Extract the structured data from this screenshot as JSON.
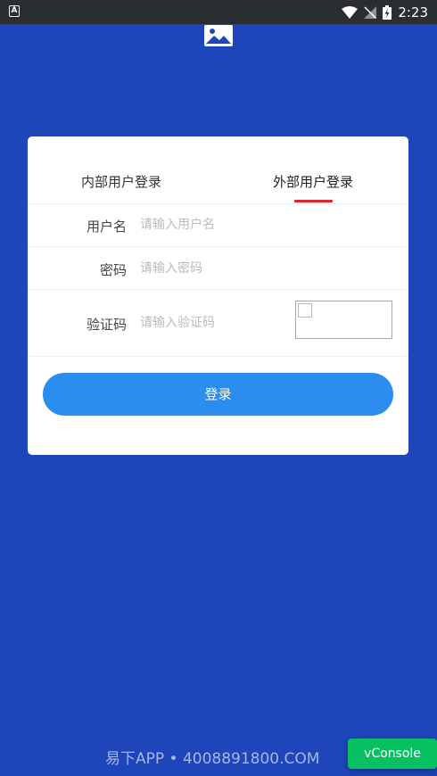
{
  "statusbar": {
    "time": "2:23",
    "app_icon_letter": "A"
  },
  "tabs": {
    "internal": "内部用户登录",
    "external": "外部用户登录",
    "active": "external",
    "active_color": "#e0242b"
  },
  "form": {
    "username_label": "用户名",
    "username_placeholder": "请输入用户名",
    "password_label": "密码",
    "password_placeholder": "请输入密码",
    "captcha_label": "验证码",
    "captcha_placeholder": "请输入验证码"
  },
  "login_button": "登录",
  "watermark": "易下APP • 4008891800.COM",
  "vconsole_label": "vConsole",
  "colors": {
    "background": "#1e45b9",
    "button": "#2b8df0",
    "vconsole": "#07c160"
  }
}
